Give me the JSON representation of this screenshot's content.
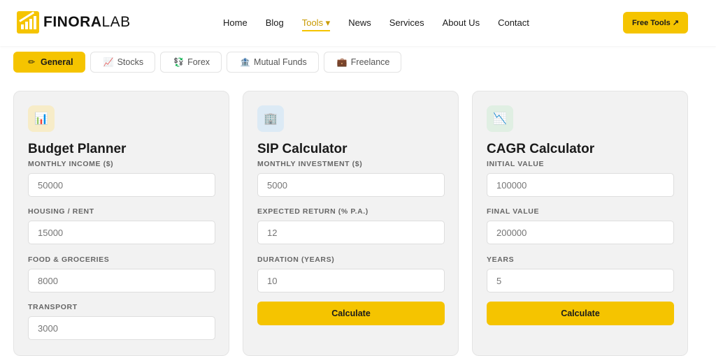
{
  "brand": {
    "name_bold": "FINORA",
    "name_light": "LAB",
    "accent": "#f5c400"
  },
  "nav": {
    "items": [
      {
        "label": "Home"
      },
      {
        "label": "Blog"
      },
      {
        "label": "Tools ▾"
      },
      {
        "label": "News"
      },
      {
        "label": "Services"
      },
      {
        "label": "About Us"
      },
      {
        "label": "Contact"
      }
    ],
    "cta": "Free Tools ↗"
  },
  "tabs": [
    {
      "label": "General",
      "icon": "✏"
    },
    {
      "label": "Stocks",
      "icon": "📈"
    },
    {
      "label": "Forex",
      "icon": "💱"
    },
    {
      "label": "Mutual Funds",
      "icon": "🏦"
    },
    {
      "label": "Freelance",
      "icon": "💼"
    }
  ],
  "cards": {
    "budget": {
      "icon": "📊",
      "title": "Budget Planner",
      "fields": [
        {
          "label": "MONTHLY INCOME ($)",
          "placeholder": "50000"
        },
        {
          "label": "HOUSING / RENT",
          "placeholder": "15000"
        },
        {
          "label": "FOOD & GROCERIES",
          "placeholder": "8000"
        },
        {
          "label": "TRANSPORT",
          "placeholder": "3000"
        }
      ]
    },
    "sip": {
      "icon": "🏢",
      "title": "SIP Calculator",
      "fields": [
        {
          "label": "MONTHLY INVESTMENT ($)",
          "placeholder": "5000"
        },
        {
          "label": "EXPECTED RETURN (% P.A.)",
          "placeholder": "12"
        },
        {
          "label": "DURATION (YEARS)",
          "placeholder": "10"
        }
      ],
      "button": "Calculate"
    },
    "cagr": {
      "icon": "📉",
      "title": "CAGR Calculator",
      "fields": [
        {
          "label": "INITIAL VALUE",
          "placeholder": "100000"
        },
        {
          "label": "FINAL VALUE",
          "placeholder": "200000"
        },
        {
          "label": "YEARS",
          "placeholder": "5"
        }
      ],
      "button": "Calculate"
    }
  }
}
